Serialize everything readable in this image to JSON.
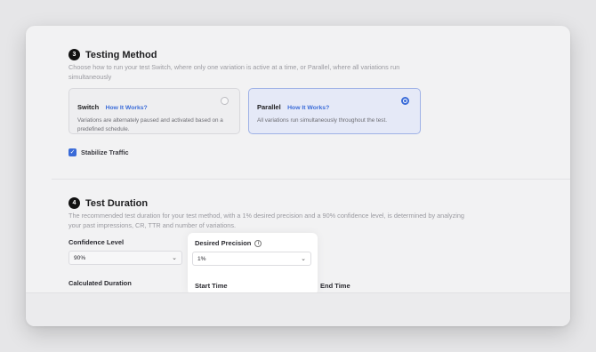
{
  "testing_method": {
    "step": "3",
    "title": "Testing Method",
    "description": "Choose how to run your test Switch, where only one variation is active at a time, or Parallel, where all variations run simultaneously",
    "options": [
      {
        "name": "Switch",
        "link": "How It Works?",
        "desc": "Variations are alternately paused and activated based on a predefined schedule.",
        "selected": false
      },
      {
        "name": "Parallel",
        "link": "How It Works?",
        "desc": "All variations run simultaneously throughout the test.",
        "selected": true
      }
    ],
    "stabilize_label": "Stabilize Traffic",
    "stabilize_checked": true
  },
  "test_duration": {
    "step": "4",
    "title": "Test Duration",
    "description": "The recommended test duration for your test method, with a 1% desired precision and a 90% confidence level, is determined by analyzing your past impressions, CR, TTR and number of variations.",
    "confidence_label": "Confidence Level",
    "confidence_value": "90%",
    "precision_label": "Desired Precision",
    "precision_value": "1%",
    "calculated_label": "Calculated Duration",
    "start_label": "Start Time",
    "end_label": "End Time"
  },
  "icons": {
    "check": "check-icon",
    "info": "info-icon",
    "chevron": "chevron-down-icon"
  },
  "colors": {
    "accent": "#3a6bd8",
    "selected_bg": "#e5e9f7"
  }
}
